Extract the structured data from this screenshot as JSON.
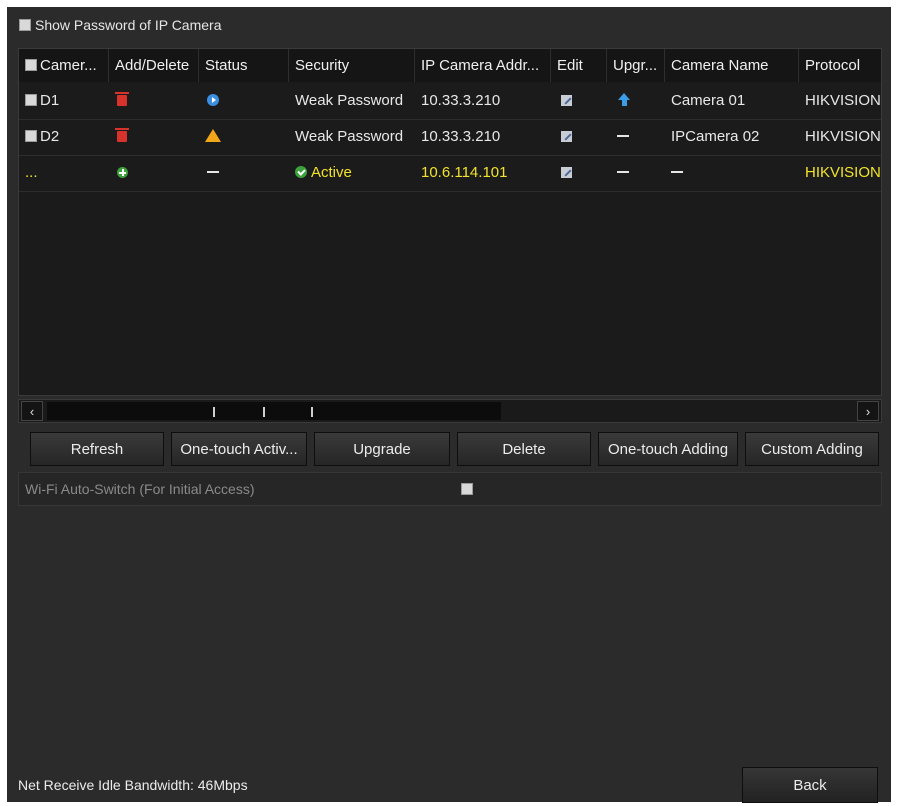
{
  "show_password": {
    "label": "Show Password of IP Camera",
    "checked": false
  },
  "table": {
    "columns": [
      "Camer...",
      "Add/Delete",
      "Status",
      "Security",
      "IP Camera Addr...",
      "Edit",
      "Upgr...",
      "Camera Name",
      "Protocol"
    ],
    "rows": [
      {
        "camera": "D1",
        "action": "delete-icon",
        "status": "play-icon",
        "security": "Weak Password",
        "ip": "10.33.3.210",
        "edit": "edit-icon",
        "upgrade": "upgrade-icon",
        "name": "Camera 01",
        "protocol": "HIKVISION"
      },
      {
        "camera": "D2",
        "action": "delete-icon",
        "status": "warning-icon",
        "security": "Weak Password",
        "ip": "10.33.3.210",
        "edit": "edit-icon",
        "upgrade": "dash",
        "name": "IPCamera 02",
        "protocol": "HIKVISION"
      },
      {
        "camera": "...",
        "action": "add-icon",
        "status": "dash",
        "security": "Active",
        "ip": "10.6.114.101",
        "edit": "edit-icon",
        "upgrade": "dash",
        "name": "-",
        "protocol": "HIKVISION",
        "highlight_color": "#f2e32b"
      }
    ]
  },
  "buttons": {
    "refresh": "Refresh",
    "one_touch_activate": "One-touch Activ...",
    "upgrade": "Upgrade",
    "delete": "Delete",
    "one_touch_adding": "One-touch Adding",
    "custom_adding": "Custom Adding"
  },
  "wifi": {
    "label": "Wi-Fi Auto-Switch (For Initial Access)",
    "checked": false
  },
  "footer": {
    "bandwidth": "Net Receive Idle Bandwidth: 46Mbps",
    "back": "Back"
  },
  "icons": {
    "scroll_left": "‹",
    "scroll_right": "›"
  }
}
